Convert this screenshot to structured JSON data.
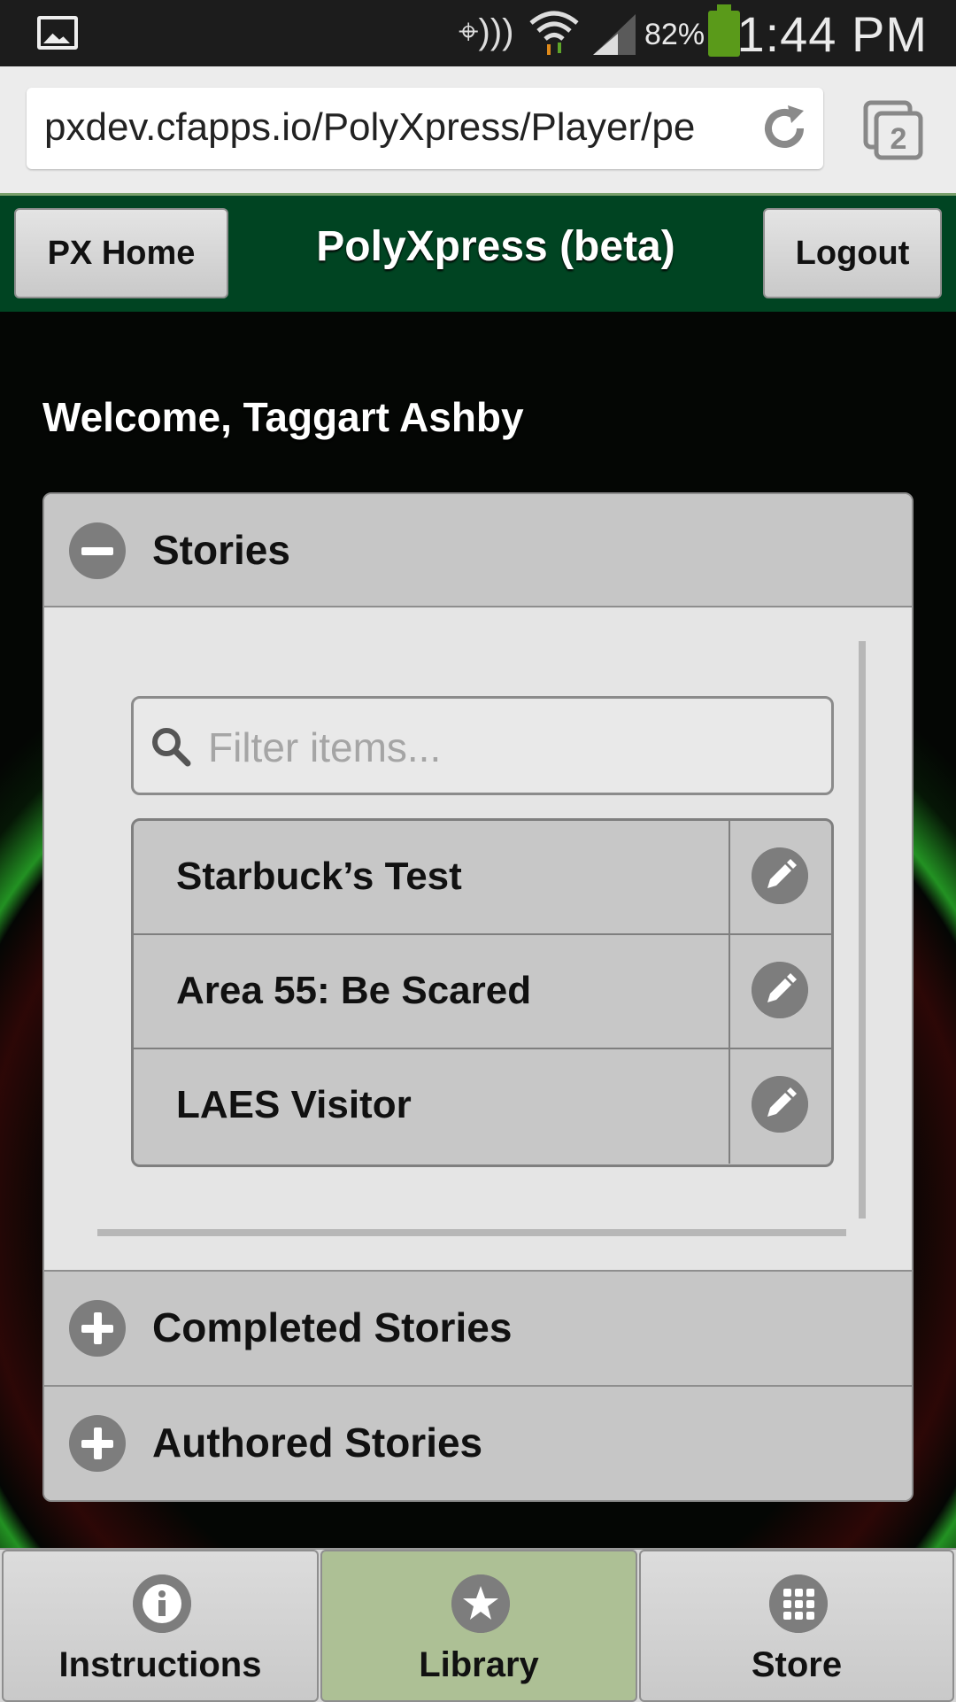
{
  "status_bar": {
    "battery_percent": "82%",
    "time": "1:44 PM",
    "tab_count": "2",
    "icons": [
      "gallery-icon",
      "nfc-icon",
      "wifi-icon",
      "signal-icon",
      "battery-icon"
    ]
  },
  "browser": {
    "url": "pxdev.cfapps.io/PolyXpress/Player/pe",
    "icons": [
      "reload-icon",
      "tabs-icon"
    ]
  },
  "header": {
    "home_label": "PX Home",
    "title": "PolyXpress (beta)",
    "logout_label": "Logout"
  },
  "welcome": "Welcome, Taggart Ashby",
  "accordion": {
    "stories": {
      "label": "Stories",
      "expanded": true,
      "filter_placeholder": "Filter items...",
      "items": [
        {
          "label": "Starbuck’s Test"
        },
        {
          "label": "Area 55: Be Scared"
        },
        {
          "label": "LAES Visitor"
        }
      ]
    },
    "completed": {
      "label": "Completed Stories",
      "expanded": false
    },
    "authored": {
      "label": "Authored Stories",
      "expanded": false
    }
  },
  "tabbar": {
    "tabs": [
      {
        "label": "Instructions",
        "icon": "info-icon",
        "active": false
      },
      {
        "label": "Library",
        "icon": "star-icon",
        "active": true
      },
      {
        "label": "Store",
        "icon": "grid-icon",
        "active": false
      }
    ]
  },
  "colors": {
    "header_bg": "#004422",
    "active_tab": "#adc095",
    "accordion_head": "#c6c6c6"
  }
}
